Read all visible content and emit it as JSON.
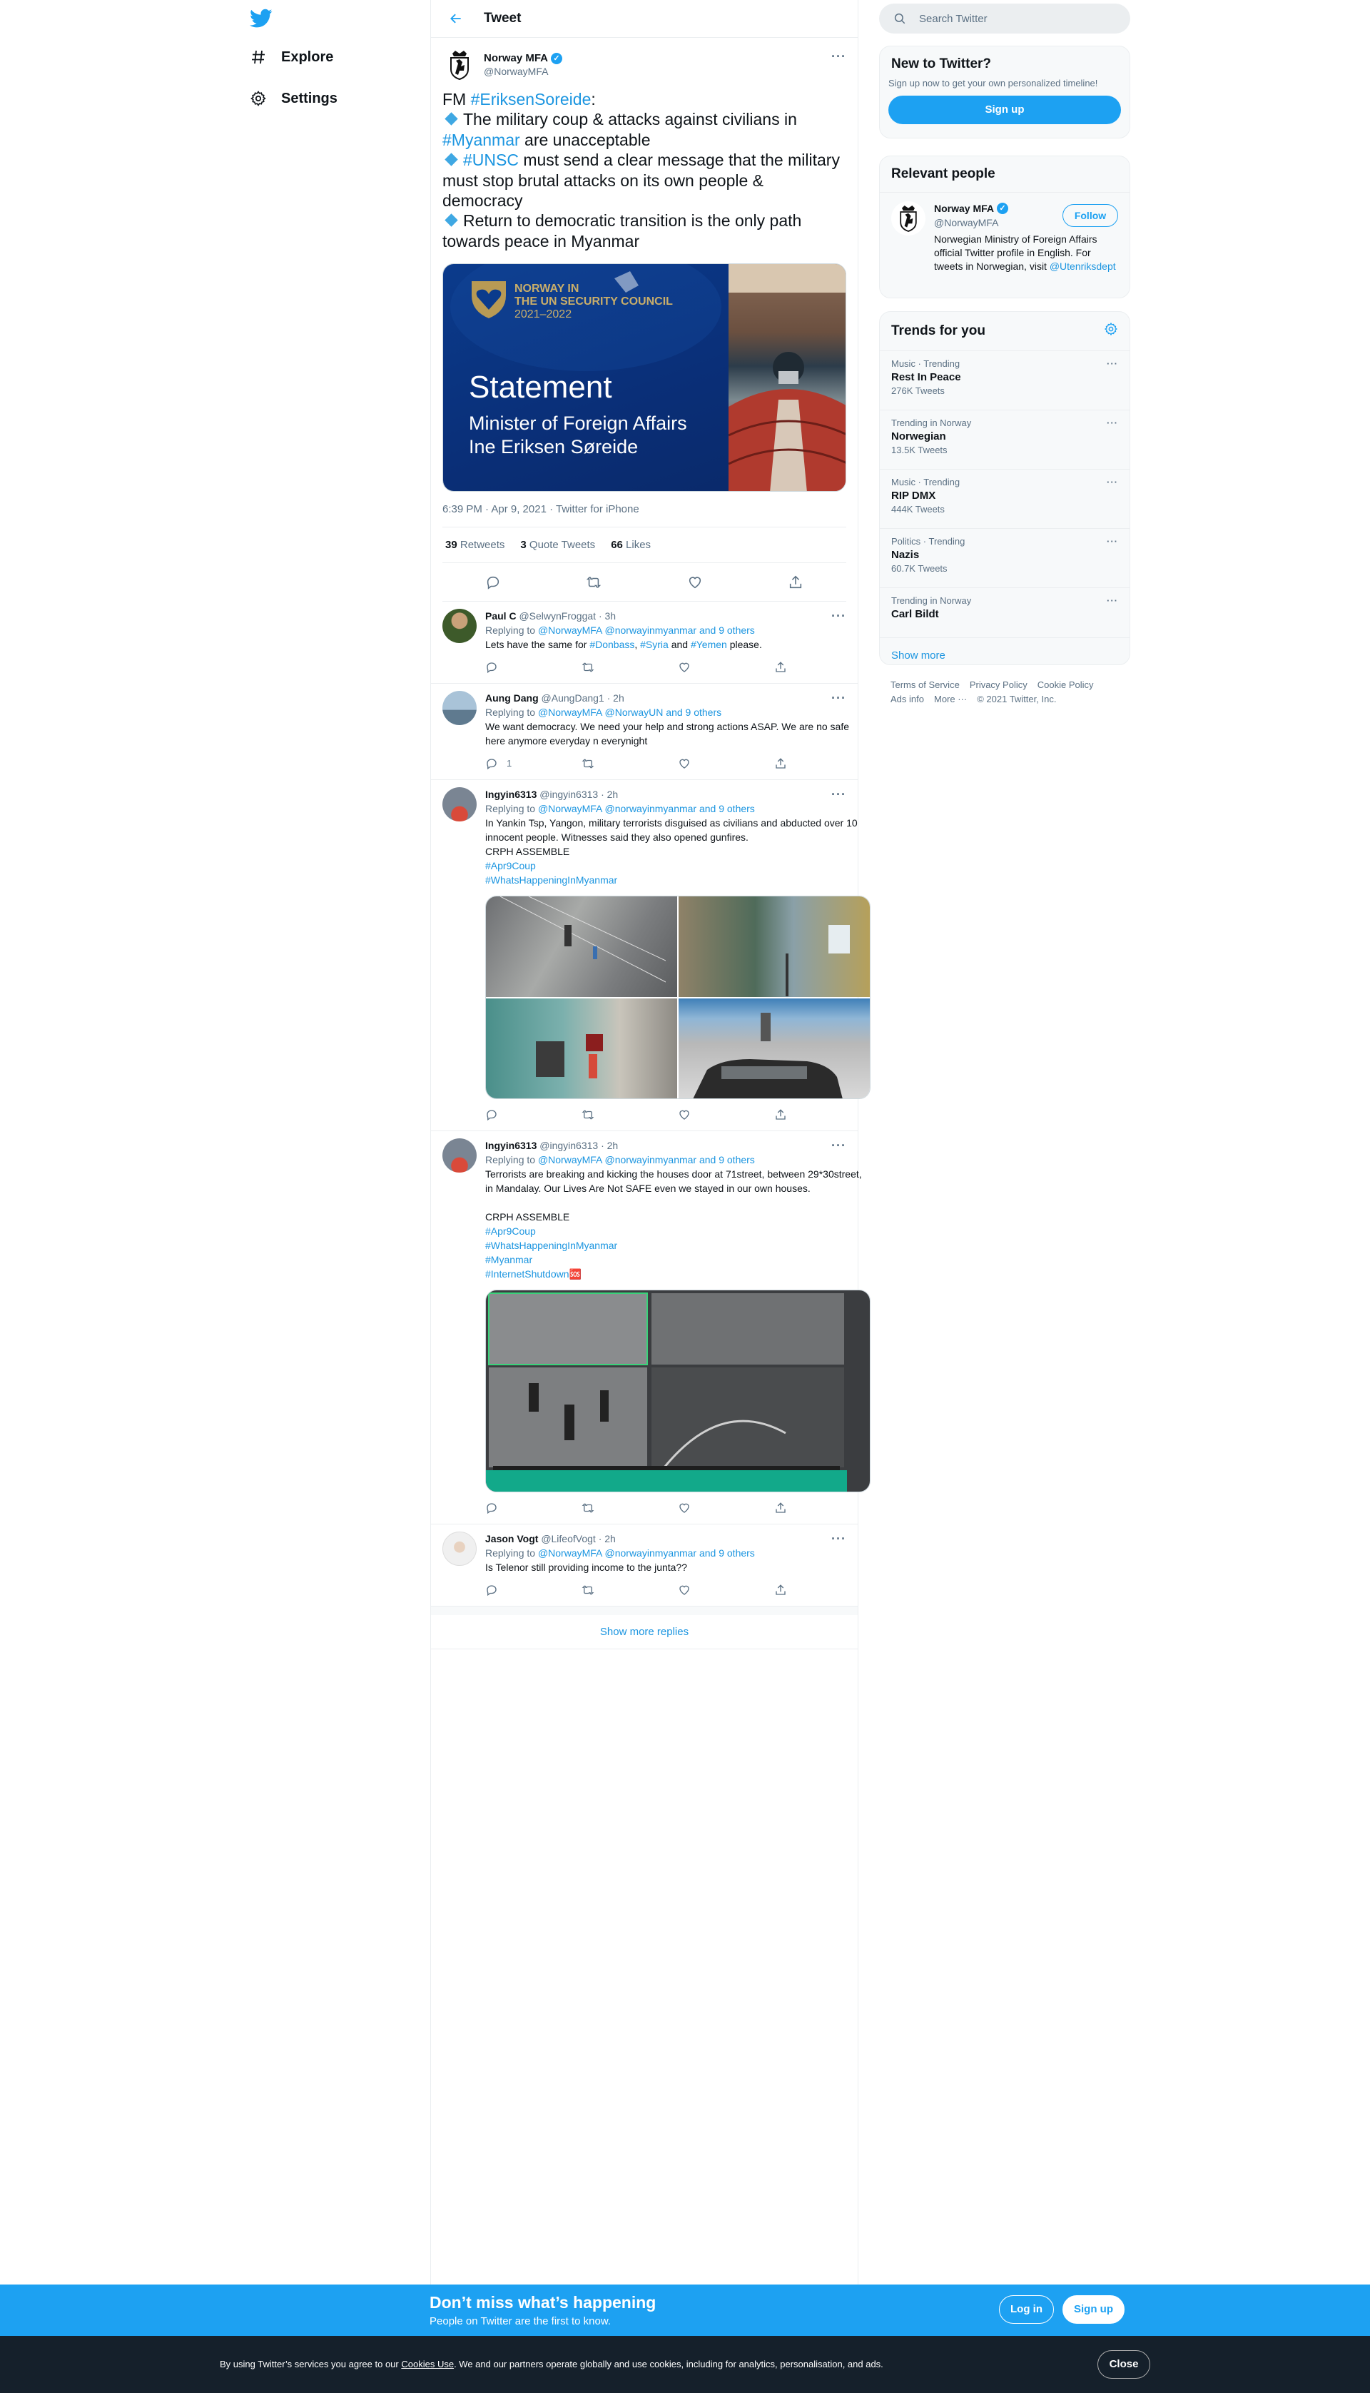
{
  "nav": {
    "explore": "Explore",
    "settings": "Settings"
  },
  "header": {
    "title": "Tweet"
  },
  "tweet": {
    "name": "Norway MFA",
    "handle": "@NorwayMFA",
    "text": {
      "l1a": "FM ",
      "l1b": "#EriksenSoreide",
      "l1c": ":",
      "l2": "The military coup & attacks against civilians in",
      "l3a": "#Myanmar",
      "l3b": " are unacceptable",
      "l4a": "#UNSC",
      "l4b": " must send a clear message that the military must stop brutal attacks on its own people & democracy",
      "l5": "Return to democratic transition is the only path towards peace in Myanmar"
    },
    "image": {
      "banner1": "NORWAY IN",
      "banner2": "THE UN SECURITY COUNCIL",
      "banner3": "2021–2022",
      "statement": "Statement",
      "sub1": "Minister of Foreign Affairs",
      "sub2": "Ine Eriksen Søreide"
    },
    "time": "6:39 PM · Apr 9, 2021 · Twitter for iPhone",
    "retweets": "39",
    "retweets_label": " Retweets",
    "quotes": "3",
    "quotes_label": " Quote Tweets",
    "likes": "66",
    "likes_label": " Likes"
  },
  "replies": [
    {
      "name": "Paul C",
      "handle": "@SelwynFroggat",
      "time": "· 3h",
      "replying": "Replying to ",
      "to": "@NorwayMFA @norwayinmyanmar and 9 others",
      "t1": "Lets have the same for ",
      "t2": "#Donbass",
      "t3": ", ",
      "t4": "#Syria",
      "t5": " and ",
      "t6": "#Yemen",
      "t7": " please.",
      "count": ""
    },
    {
      "name": "Aung Dang",
      "handle": "@AungDang1",
      "time": "· 2h",
      "replying": "Replying to ",
      "to": "@NorwayMFA @NorwayUN and 9 others",
      "text": "We want democracy. We need your help and strong actions ASAP. We are no safe here anymore everyday n everynight",
      "count": "1"
    },
    {
      "name": "Ingyin6313",
      "handle": "@ingyin6313",
      "time": "· 2h",
      "replying": "Replying to ",
      "to": "@NorwayMFA @norwayinmyanmar and 9 others",
      "text": "In Yankin Tsp, Yangon, military terrorists disguised as civilians and abducted over 10 innocent people. Witnesses said they also opened gunfires.",
      "crph": "CRPH ASSEMBLE",
      "h1": "#Apr9Coup",
      "h2": "#WhatsHappeningInMyanmar"
    },
    {
      "name": "Ingyin6313",
      "handle": "@ingyin6313",
      "time": "· 2h",
      "replying": "Replying to ",
      "to": "@NorwayMFA @norwayinmyanmar and 9 others",
      "text": "Terrorists are breaking and kicking the houses door at 71street, between 29*30street, in Mandalay. Our Lives Are Not SAFE even we stayed in our own houses.",
      "crph": "CRPH ASSEMBLE",
      "h1": "#Apr9Coup",
      "h2": "#WhatsHappeningInMyanmar",
      "h3": "#Myanmar",
      "h4": "#InternetShutdown",
      "emoji": "🆘"
    },
    {
      "name": "Jason Vogt",
      "handle": "@LifeofVogt",
      "time": "· 2h",
      "replying": "Replying to ",
      "to": "@NorwayMFA @norwayinmyanmar and 9 others",
      "text": "Is Telenor still providing income to the junta??"
    }
  ],
  "show_more_replies": "Show more replies",
  "right": {
    "search_placeholder": "Search Twitter",
    "new_title": "New to Twitter?",
    "new_sub": "Sign up now to get your own personalized timeline!",
    "signup": "Sign up",
    "relevant_title": "Relevant people",
    "person_name": "Norway MFA",
    "person_handle": "@NorwayMFA",
    "follow": "Follow",
    "bio": "Norwegian Ministry of Foreign Affairs official Twitter profile in English. For tweets in Norwegian, visit ",
    "bio_link": "@Utenriksdept",
    "trends_title": "Trends for you",
    "trends": [
      {
        "cat": "Music · Trending",
        "name": "Rest In Peace",
        "count": "276K Tweets"
      },
      {
        "cat": "Trending in Norway",
        "name": "Norwegian",
        "count": "13.5K Tweets"
      },
      {
        "cat": "Music · Trending",
        "name": "RIP DMX",
        "count": "444K Tweets"
      },
      {
        "cat": "Politics · Trending",
        "name": "Nazis",
        "count": "60.7K Tweets"
      },
      {
        "cat": "Trending in Norway",
        "name": "Carl Bildt",
        "count": ""
      }
    ],
    "show_more": "Show more",
    "footer": {
      "terms": "Terms of Service",
      "privacy": "Privacy Policy",
      "cookie": "Cookie Policy",
      "ads": "Ads info",
      "more": "More ···",
      "copy": "© 2021 Twitter, Inc."
    }
  },
  "bottom": {
    "title": "Don’t miss what’s happening",
    "sub": "People on Twitter are the first to know.",
    "login": "Log in",
    "signup": "Sign up"
  },
  "cookie": {
    "text1": "By using Twitter’s services you agree to our ",
    "link": "Cookies Use",
    "text2": ". We and our partners operate globally and use cookies, including for analytics, personalisation, and ads.",
    "close": "Close"
  },
  "colors": {
    "accent": "#1da1f2",
    "link": "#1b95e0",
    "secondary": "#5b7083",
    "cookie_bg": "#15202b"
  }
}
